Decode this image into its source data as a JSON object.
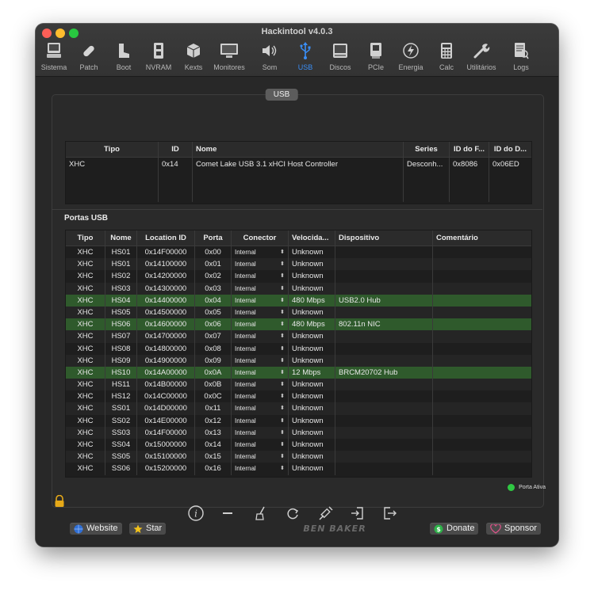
{
  "window": {
    "title": "Hackintool v4.0.3"
  },
  "toolbar": [
    {
      "label": "Sistema",
      "icon": "computer-icon"
    },
    {
      "label": "Patch",
      "icon": "bandage-icon"
    },
    {
      "label": "Boot",
      "icon": "boot-icon"
    },
    {
      "label": "NVRAM",
      "icon": "memory-icon"
    },
    {
      "label": "Kexts",
      "icon": "package-icon"
    },
    {
      "label": "Monitores",
      "icon": "monitor-icon"
    },
    {
      "label": "Som",
      "icon": "speaker-icon"
    },
    {
      "label": "USB",
      "icon": "usb-icon",
      "active": true
    },
    {
      "label": "Discos",
      "icon": "disk-icon"
    },
    {
      "label": "PCIe",
      "icon": "pcie-icon"
    },
    {
      "label": "Energia",
      "icon": "energy-icon"
    },
    {
      "label": "Calc",
      "icon": "calculator-icon"
    },
    {
      "label": "Utilitários",
      "icon": "wrench-icon"
    },
    {
      "label": "Logs",
      "icon": "logs-icon"
    }
  ],
  "usb_section_label": "USB",
  "controller_table": {
    "headers": [
      "Tipo",
      "ID",
      "Nome",
      "Series",
      "ID do F...",
      "ID do D..."
    ],
    "rows": [
      [
        "XHC",
        "0x14",
        "Comet Lake USB 3.1 xHCI Host Controller",
        "Desconh...",
        "0x8086",
        "0x06ED"
      ]
    ]
  },
  "ports_title": "Portas USB",
  "ports_table": {
    "headers": [
      "Tipo",
      "Nome",
      "Location ID",
      "Porta",
      "Conector",
      "Velocida...",
      "Dispositivo",
      "Comentário"
    ],
    "rows": [
      {
        "tipo": "XHC",
        "nome": "HS01",
        "loc": "0x14F00000",
        "porta": "0x00",
        "con": "Internal",
        "vel": "Unknown",
        "disp": "",
        "com": ""
      },
      {
        "tipo": "XHC",
        "nome": "HS01",
        "loc": "0x14100000",
        "porta": "0x01",
        "con": "Internal",
        "vel": "Unknown",
        "disp": "",
        "com": ""
      },
      {
        "tipo": "XHC",
        "nome": "HS02",
        "loc": "0x14200000",
        "porta": "0x02",
        "con": "Internal",
        "vel": "Unknown",
        "disp": "",
        "com": ""
      },
      {
        "tipo": "XHC",
        "nome": "HS03",
        "loc": "0x14300000",
        "porta": "0x03",
        "con": "Internal",
        "vel": "Unknown",
        "disp": "",
        "com": ""
      },
      {
        "tipo": "XHC",
        "nome": "HS04",
        "loc": "0x14400000",
        "porta": "0x04",
        "con": "Internal",
        "vel": "480 Mbps",
        "disp": "USB2.0 Hub",
        "com": "",
        "active": true
      },
      {
        "tipo": "XHC",
        "nome": "HS05",
        "loc": "0x14500000",
        "porta": "0x05",
        "con": "Internal",
        "vel": "Unknown",
        "disp": "",
        "com": ""
      },
      {
        "tipo": "XHC",
        "nome": "HS06",
        "loc": "0x14600000",
        "porta": "0x06",
        "con": "Internal",
        "vel": "480 Mbps",
        "disp": "802.11n NIC",
        "com": "",
        "active": true
      },
      {
        "tipo": "XHC",
        "nome": "HS07",
        "loc": "0x14700000",
        "porta": "0x07",
        "con": "Internal",
        "vel": "Unknown",
        "disp": "",
        "com": ""
      },
      {
        "tipo": "XHC",
        "nome": "HS08",
        "loc": "0x14800000",
        "porta": "0x08",
        "con": "Internal",
        "vel": "Unknown",
        "disp": "",
        "com": ""
      },
      {
        "tipo": "XHC",
        "nome": "HS09",
        "loc": "0x14900000",
        "porta": "0x09",
        "con": "Internal",
        "vel": "Unknown",
        "disp": "",
        "com": ""
      },
      {
        "tipo": "XHC",
        "nome": "HS10",
        "loc": "0x14A00000",
        "porta": "0x0A",
        "con": "Internal",
        "vel": "12 Mbps",
        "disp": "BRCM20702 Hub",
        "com": "",
        "active": true
      },
      {
        "tipo": "XHC",
        "nome": "HS11",
        "loc": "0x14B00000",
        "porta": "0x0B",
        "con": "Internal",
        "vel": "Unknown",
        "disp": "",
        "com": ""
      },
      {
        "tipo": "XHC",
        "nome": "HS12",
        "loc": "0x14C00000",
        "porta": "0x0C",
        "con": "Internal",
        "vel": "Unknown",
        "disp": "",
        "com": ""
      },
      {
        "tipo": "XHC",
        "nome": "SS01",
        "loc": "0x14D00000",
        "porta": "0x11",
        "con": "Internal",
        "vel": "Unknown",
        "disp": "",
        "com": ""
      },
      {
        "tipo": "XHC",
        "nome": "SS02",
        "loc": "0x14E00000",
        "porta": "0x12",
        "con": "Internal",
        "vel": "Unknown",
        "disp": "",
        "com": ""
      },
      {
        "tipo": "XHC",
        "nome": "SS03",
        "loc": "0x14F00000",
        "porta": "0x13",
        "con": "Internal",
        "vel": "Unknown",
        "disp": "",
        "com": ""
      },
      {
        "tipo": "XHC",
        "nome": "SS04",
        "loc": "0x15000000",
        "porta": "0x14",
        "con": "Internal",
        "vel": "Unknown",
        "disp": "",
        "com": ""
      },
      {
        "tipo": "XHC",
        "nome": "SS05",
        "loc": "0x15100000",
        "porta": "0x15",
        "con": "Internal",
        "vel": "Unknown",
        "disp": "",
        "com": ""
      },
      {
        "tipo": "XHC",
        "nome": "SS06",
        "loc": "0x15200000",
        "porta": "0x16",
        "con": "Internal",
        "vel": "Unknown",
        "disp": "",
        "com": ""
      }
    ]
  },
  "legend": {
    "label": "Porta Ativa",
    "color": "#2fc843"
  },
  "actions": [
    "info-icon",
    "minus-icon",
    "broom-icon",
    "refresh-icon",
    "injector-icon",
    "import-icon",
    "export-icon"
  ],
  "footer": {
    "website": "Website",
    "star": "Star",
    "logo": "BEN BAKER",
    "donate": "Donate",
    "sponsor": "Sponsor"
  },
  "colors": {
    "accent": "#3a8ef6",
    "active_row": "#2f5a2c",
    "window_bg": "#232323"
  }
}
